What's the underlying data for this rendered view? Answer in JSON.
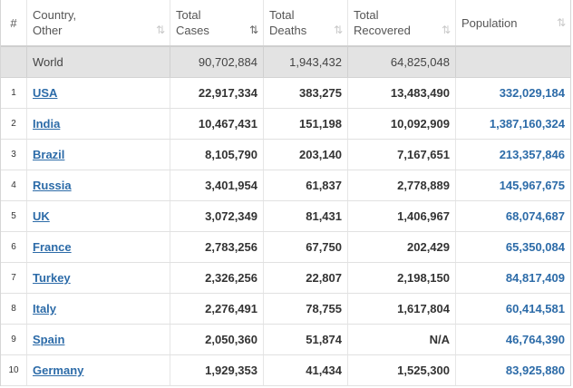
{
  "table": {
    "headers": {
      "index": "#",
      "country": "Country,\nOther",
      "total_cases": "Total\nCases",
      "total_deaths": "Total\nDeaths",
      "total_recovered": "Total\nRecovered",
      "population": "Population"
    },
    "sort_icons": {
      "country": "⇅",
      "total_cases": "⇅",
      "total_deaths": "⇅",
      "total_recovered": "⇅",
      "population": "⇅"
    },
    "world": {
      "label": "World",
      "total_cases": "90,702,884",
      "total_deaths": "1,943,432",
      "total_recovered": "64,825,048",
      "population": ""
    },
    "rows": [
      {
        "index": "1",
        "country": "USA",
        "total_cases": "22,917,334",
        "total_deaths": "383,275",
        "total_recovered": "13,483,490",
        "population": "332,029,184"
      },
      {
        "index": "2",
        "country": "India",
        "total_cases": "10,467,431",
        "total_deaths": "151,198",
        "total_recovered": "10,092,909",
        "population": "1,387,160,324"
      },
      {
        "index": "3",
        "country": "Brazil",
        "total_cases": "8,105,790",
        "total_deaths": "203,140",
        "total_recovered": "7,167,651",
        "population": "213,357,846"
      },
      {
        "index": "4",
        "country": "Russia",
        "total_cases": "3,401,954",
        "total_deaths": "61,837",
        "total_recovered": "2,778,889",
        "population": "145,967,675"
      },
      {
        "index": "5",
        "country": "UK",
        "total_cases": "3,072,349",
        "total_deaths": "81,431",
        "total_recovered": "1,406,967",
        "population": "68,074,687"
      },
      {
        "index": "6",
        "country": "France",
        "total_cases": "2,783,256",
        "total_deaths": "67,750",
        "total_recovered": "202,429",
        "population": "65,350,084"
      },
      {
        "index": "7",
        "country": "Turkey",
        "total_cases": "2,326,256",
        "total_deaths": "22,807",
        "total_recovered": "2,198,150",
        "population": "84,817,409"
      },
      {
        "index": "8",
        "country": "Italy",
        "total_cases": "2,276,491",
        "total_deaths": "78,755",
        "total_recovered": "1,617,804",
        "population": "60,414,581"
      },
      {
        "index": "9",
        "country": "Spain",
        "total_cases": "2,050,360",
        "total_deaths": "51,874",
        "total_recovered": "N/A",
        "population": "46,764,390"
      },
      {
        "index": "10",
        "country": "Germany",
        "total_cases": "1,929,353",
        "total_deaths": "41,434",
        "total_recovered": "1,525,300",
        "population": "83,925,880"
      }
    ]
  },
  "colors": {
    "link": "#2c6ba8",
    "world_row_bg": "#e3e3e3"
  }
}
